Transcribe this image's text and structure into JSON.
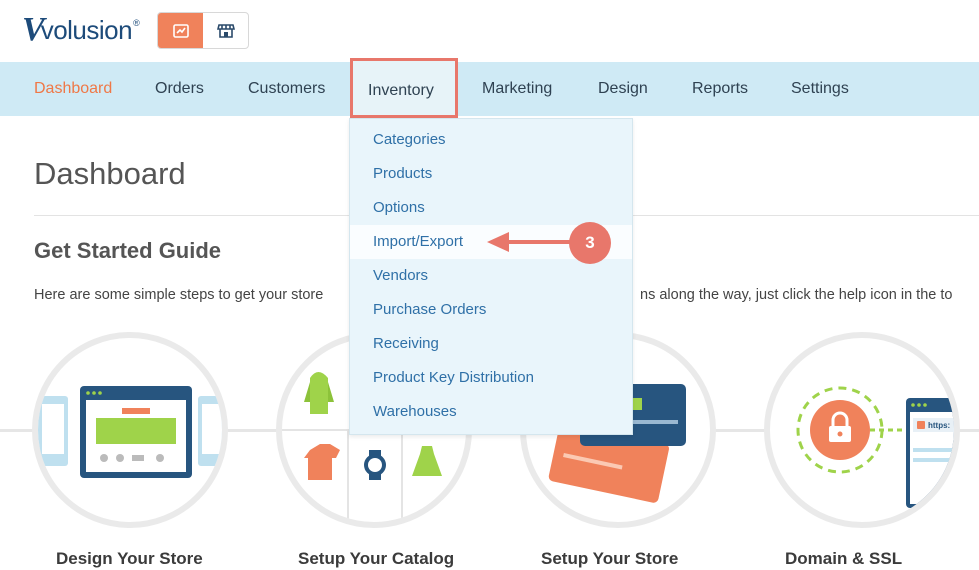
{
  "brand": {
    "logo_mark": "V",
    "logo_text": "volusion",
    "registered": "®"
  },
  "mode_switch": [
    {
      "icon": "analytics-icon",
      "active": true
    },
    {
      "icon": "storefront-icon",
      "active": false
    }
  ],
  "nav": {
    "items": [
      "Dashboard",
      "Orders",
      "Customers",
      "Inventory",
      "Marketing",
      "Design",
      "Reports",
      "Settings"
    ],
    "active": "Dashboard",
    "open_menu": "Inventory"
  },
  "dropdown": {
    "items": [
      "Categories",
      "Products",
      "Options",
      "Import/Export",
      "Vendors",
      "Purchase Orders",
      "Receiving",
      "Product Key Distribution",
      "Warehouses"
    ],
    "highlighted": "Import/Export"
  },
  "annotation": {
    "step": "3"
  },
  "page": {
    "title": "Dashboard",
    "section_title": "Get Started Guide",
    "intro_left": "Here are some simple steps to get your store",
    "intro_right": "ns along the way, just click the help icon in the to"
  },
  "steps": [
    {
      "label": "Design Your Store"
    },
    {
      "label": "Setup Your Catalog"
    },
    {
      "label": "Setup Your Store"
    },
    {
      "label": "Domain & SSL",
      "badge_text": "https:"
    }
  ],
  "colors": {
    "accent_orange": "#f0825b",
    "nav_bg": "#cfeaf5",
    "dropdown_bg": "#e9f5fb",
    "link_blue": "#2f70a7",
    "annotation_red": "#e8776b",
    "brand_blue": "#1d4b7a"
  }
}
